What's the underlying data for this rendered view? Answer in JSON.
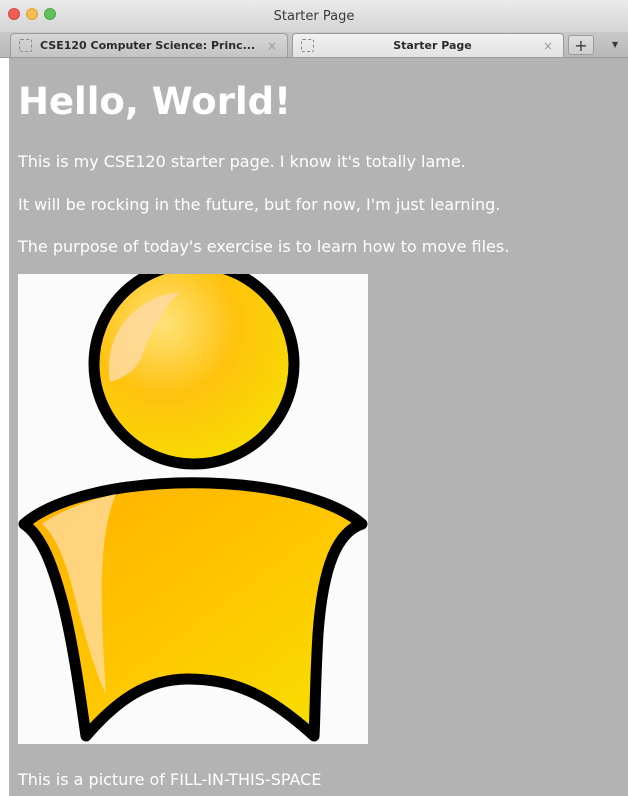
{
  "window": {
    "title": "Starter Page"
  },
  "tabs": [
    {
      "label": "CSE120 Computer Science: Princ...",
      "active": false
    },
    {
      "label": "Starter Page",
      "active": true
    }
  ],
  "icons": {
    "close_tab": "×",
    "new_tab": "+",
    "overflow": "▼"
  },
  "page": {
    "heading": "Hello, World!",
    "paragraphs": [
      "This is my CSE120 starter page. I know it's totally lame.",
      "It will be rocking in the future, but for now, I'm just learning.",
      "The purpose of today's exercise is to learn how to move files."
    ],
    "caption": "This is a picture of FILL-IN-THIS-SPACE",
    "background_color": "#b3b3b3",
    "text_color": "#ffffff"
  },
  "image": {
    "subject": "yellow-user-icon"
  }
}
